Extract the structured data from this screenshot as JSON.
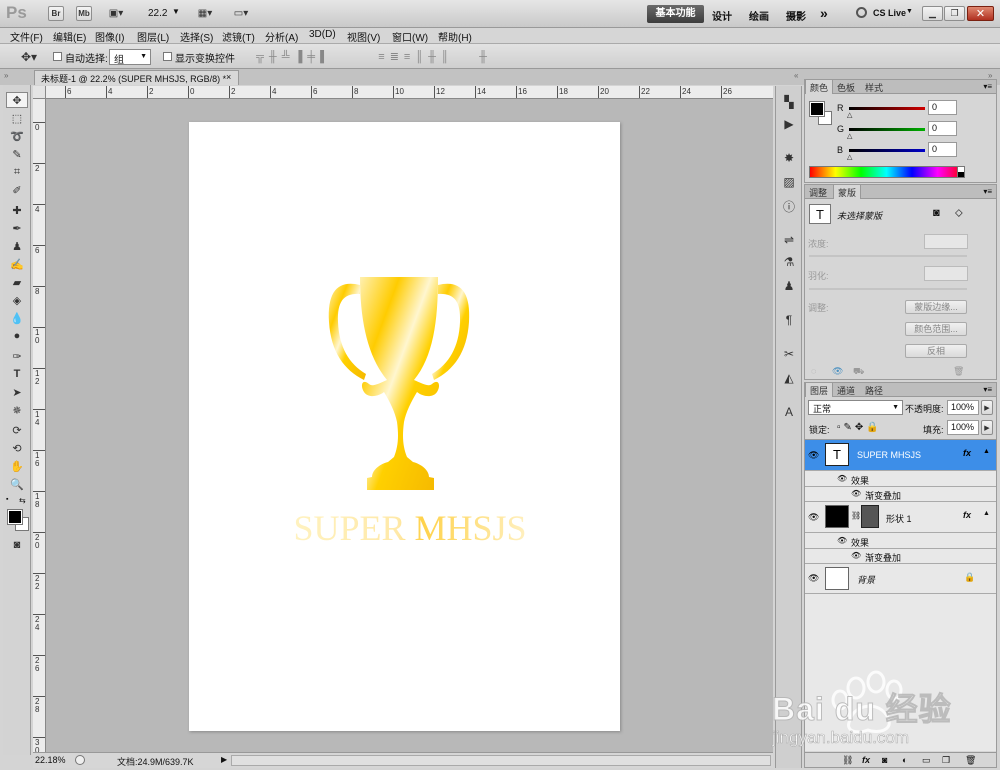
{
  "appbar": {
    "logo": "Ps",
    "br_label": "Br",
    "mb_label": "Mb",
    "zoom": "22.2",
    "workspaces": [
      "基本功能",
      "设计",
      "绘画",
      "摄影"
    ],
    "more": "»",
    "cslive": "CS Live"
  },
  "menu": [
    "文件(F)",
    "编辑(E)",
    "图像(I)",
    "图层(L)",
    "选择(S)",
    "滤镜(T)",
    "分析(A)",
    "3D(D)",
    "视图(V)",
    "窗口(W)",
    "帮助(H)"
  ],
  "options": {
    "auto_select_label": "自动选择:",
    "auto_select_value": "组",
    "show_transform_label": "显示变换控件"
  },
  "document_tab": {
    "title": "未标题-1 @ 22.2% (SUPER MHSJS, RGB/8) *",
    "close": "×"
  },
  "ruler": {
    "top": [
      "6",
      "4",
      "2",
      "0",
      "2",
      "4",
      "6",
      "8",
      "10",
      "12",
      "14",
      "16",
      "18",
      "20",
      "22",
      "24",
      "26"
    ],
    "left": [
      "0",
      "2",
      "4",
      "6",
      "8",
      "1 0",
      "1 2",
      "1 4",
      "1 6",
      "1 8",
      "2 0",
      "2 2",
      "2 4",
      "2 6",
      "2 8",
      "3 0"
    ]
  },
  "canvas": {
    "text": "SUPER MHSJS",
    "trophy_color": "#ffc800"
  },
  "status": {
    "zoom": "22.18%",
    "doc_info": "文档:24.9M/639.7K"
  },
  "color_panel": {
    "tabs": [
      "颜色",
      "色板",
      "样式"
    ],
    "channels": [
      {
        "label": "R",
        "value": "0",
        "color": "#d00000"
      },
      {
        "label": "G",
        "value": "0",
        "color": "#00b000"
      },
      {
        "label": "B",
        "value": "0",
        "color": "#0000c8"
      }
    ]
  },
  "masks_panel": {
    "tabs": [
      "调整",
      "蒙版"
    ],
    "title": "未选择蒙版",
    "density_label": "浓度:",
    "feather_label": "羽化:",
    "refine_label": "调整:",
    "btn_mask_edge": "蒙版边缘...",
    "btn_color_range": "颜色范围...",
    "btn_invert": "反相"
  },
  "layers_panel": {
    "tabs": [
      "图层",
      "通道",
      "路径"
    ],
    "blend_mode": "正常",
    "opacity_label": "不透明度:",
    "opacity_value": "100%",
    "lock_label": "锁定:",
    "fill_label": "填充:",
    "fill_value": "100%",
    "layers": [
      {
        "name": "SUPER MHSJS",
        "effects_label": "效果",
        "effect": "渐变叠加"
      },
      {
        "name": "形状 1",
        "effects_label": "效果",
        "effect": "渐变叠加"
      },
      {
        "name": "背景"
      }
    ],
    "fx": "fx"
  },
  "watermark": {
    "brand": "Bai du 经验",
    "url": "jingyan.baidu.com"
  }
}
